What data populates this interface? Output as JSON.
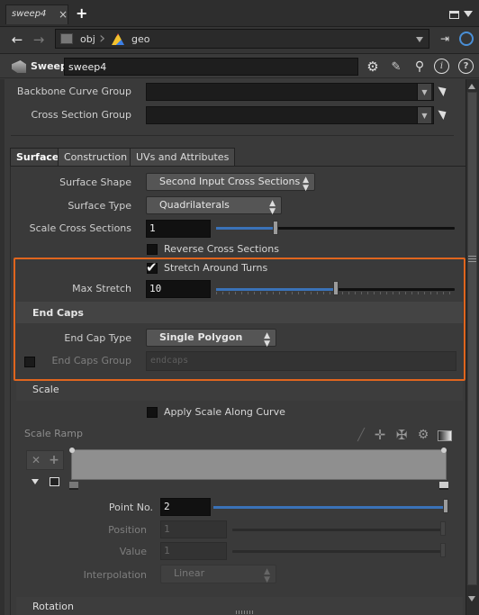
{
  "tab": {
    "title": "sweep4",
    "close": "×",
    "new": "+"
  },
  "path": {
    "obj": "obj",
    "geo": "geo"
  },
  "node": {
    "type": "Sweep",
    "name": "sweep4"
  },
  "params": {
    "backbone_label": "Backbone Curve Group",
    "cross_label": "Cross Section Group",
    "tabs": [
      "Surface",
      "Construction",
      "UVs and Attributes"
    ],
    "surface_shape_label": "Surface Shape",
    "surface_shape_value": "Second Input Cross Sections",
    "surface_type_label": "Surface Type",
    "surface_type_value": "Quadrilaterals",
    "scale_cross_label": "Scale Cross Sections",
    "scale_cross_value": "1",
    "reverse_label": "Reverse Cross Sections",
    "stretch_label": "Stretch Around Turns",
    "max_stretch_label": "Max Stretch",
    "max_stretch_value": "10",
    "end_caps_heading": "End Caps",
    "end_cap_type_label": "End Cap Type",
    "end_cap_type_value": "Single Polygon",
    "end_caps_group_label": "End Caps Group",
    "end_caps_group_placeholder": "endcaps",
    "scale_heading": "Scale",
    "apply_scale_label": "Apply Scale Along Curve",
    "scale_ramp_label": "Scale Ramp",
    "point_no_label": "Point No.",
    "point_no_value": "2",
    "position_label": "Position",
    "position_value": "1",
    "value_label": "Value",
    "value_value": "1",
    "interp_label": "Interpolation",
    "interp_value": "Linear",
    "rotation_heading": "Rotation"
  },
  "sliders": {
    "scale_cross": 0.25,
    "max_stretch": 0.5,
    "point_no": 1.0
  },
  "colors": {
    "highlight": "#e0651e",
    "slider_fill": "#3a72b8"
  }
}
